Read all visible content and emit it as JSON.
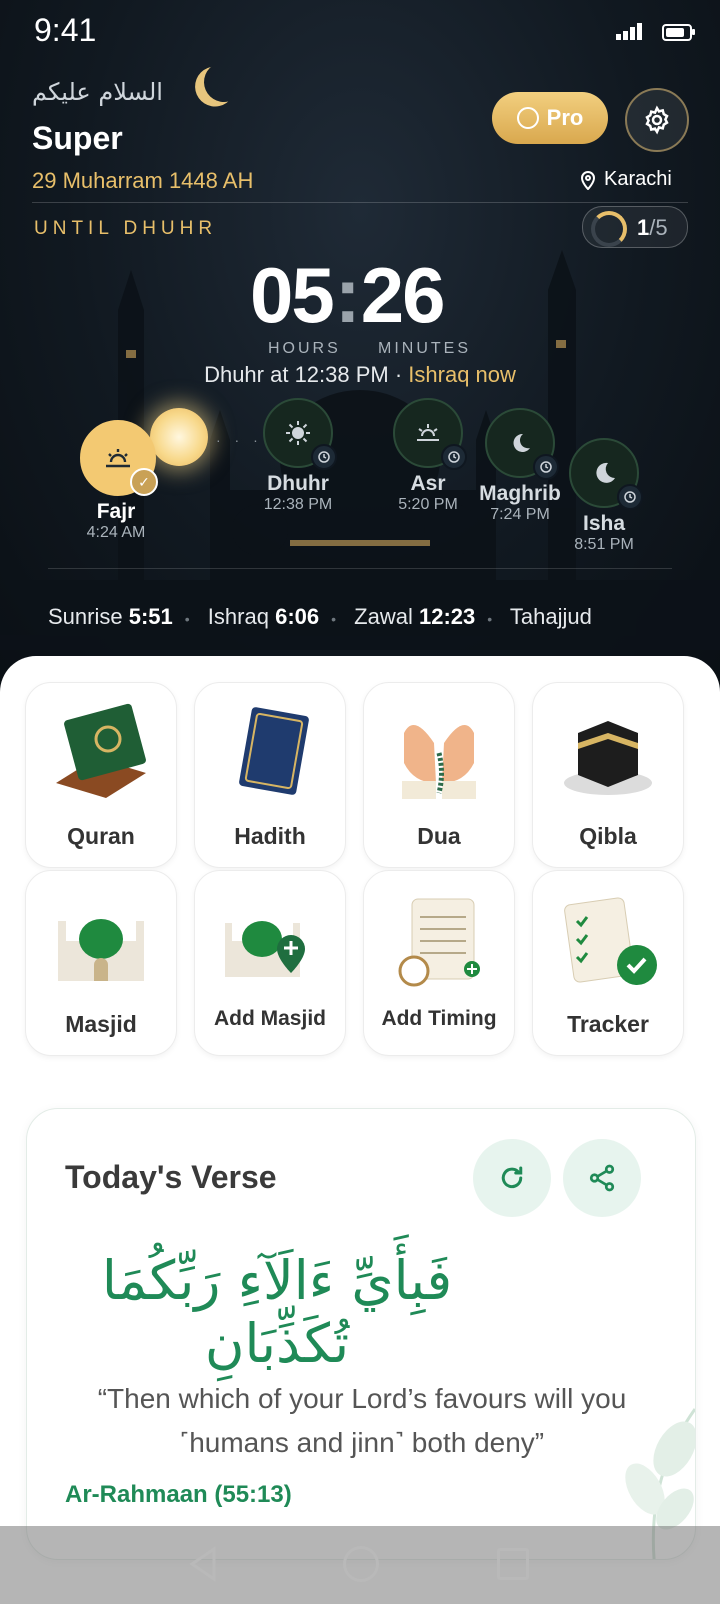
{
  "status": {
    "time": "9:41"
  },
  "header": {
    "greeting": "السلام عليكم",
    "user_name": "Super",
    "hijri_date": "29 Muharram 1448 AH",
    "pro_label": "Pro",
    "location": "Karachi"
  },
  "countdown": {
    "label": "UNTIL DHUHR",
    "hours": "05",
    "minutes": "26",
    "hours_label": "HOURS",
    "minutes_label": "MINUTES",
    "next_prayer_text": "Dhuhr at 12:38 PM · ",
    "current_text": "Ishraq now",
    "progress_done": "1",
    "progress_total": "/5"
  },
  "prayers": [
    {
      "name": "Fajr",
      "time": "4:24 AM",
      "status": "done"
    },
    {
      "name": "Dhuhr",
      "time": "12:38 PM"
    },
    {
      "name": "Asr",
      "time": "5:20 PM"
    },
    {
      "name": "Maghrib",
      "time": "7:24 PM"
    },
    {
      "name": "Isha",
      "time": "8:51 PM"
    }
  ],
  "times_row": [
    {
      "label": "Sunrise",
      "value": "5:51"
    },
    {
      "label": "Ishraq",
      "value": "6:06"
    },
    {
      "label": "Zawal",
      "value": "12:23"
    },
    {
      "label": "Tahajjud",
      "value": ""
    }
  ],
  "features": [
    {
      "label": "Quran",
      "icon": "quran-book-icon"
    },
    {
      "label": "Hadith",
      "icon": "hadith-book-icon"
    },
    {
      "label": "Dua",
      "icon": "dua-hands-icon"
    },
    {
      "label": "Qibla",
      "icon": "kaaba-icon"
    },
    {
      "label": "Masjid",
      "icon": "mosque-icon"
    },
    {
      "label": "Add Masjid",
      "icon": "add-mosque-icon"
    },
    {
      "label": "Add Timing",
      "icon": "timing-calendar-icon"
    },
    {
      "label": "Tracker",
      "icon": "tracker-checklist-icon"
    }
  ],
  "verse": {
    "title": "Today's Verse",
    "arabic": "فَبِأَيِّ ءَالَآءِ رَبِّكُمَا تُكَذِّبَانِ",
    "translation": "“Then which of your Lord’s favours will you ˹humans and jinn˺ both deny”",
    "reference": "Ar-Rahmaan (55:13)"
  },
  "colors": {
    "accent_gold": "#e8bf6a",
    "accent_green": "#1f8a57",
    "hero_bg": "#111921"
  }
}
